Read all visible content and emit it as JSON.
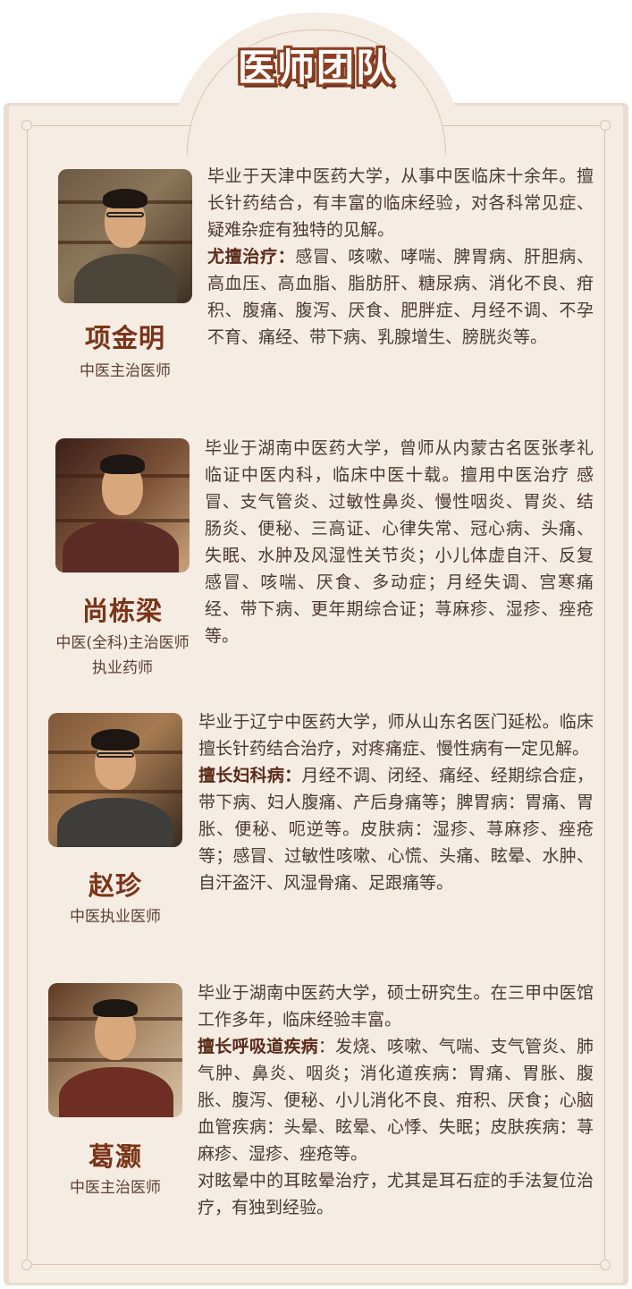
{
  "header": {
    "title": "医师团队"
  },
  "doctors": [
    {
      "name": "项金明",
      "titles": [
        "中医主治医师"
      ],
      "intro": "毕业于天津中医药大学，从事中医临床十余年。擅长针药结合，有丰富的临床经验，对各科常见症、疑难杂症有独特的见解。",
      "specialty_label": "尤擅治疗：",
      "specialty_text": "感冒、咳嗽、哮喘、脾胃病、肝胆病、高血压、高血脂、脂肪肝、糖尿病、消化不良、疳积、腹痛、腹泻、厌食、肥胖症、月经不调、不孕不育、痛经、带下病、乳腺增生、膀胱炎等。"
    },
    {
      "name": "尚栋梁",
      "titles": [
        "中医(全科)主治医师",
        "执业药师"
      ],
      "intro": "毕业于湖南中医药大学，曾师从内蒙古名医张孝礼临证中医内科，临床中医十载。擅用中医治疗 感冒、支气管炎、过敏性鼻炎、慢性咽炎、胃炎、结肠炎、便秘、三高证、心律失常、冠心病、头痛、失眠、水肿及风湿性关节炎；小儿体虚自汗、反复感冒、咳喘、厌食、多动症；月经失调、宫寒痛经、带下病、更年期综合证；荨麻疹、湿疹、痤疮等。"
    },
    {
      "name": "赵珍",
      "titles": [
        "中医执业医师"
      ],
      "intro": "毕业于辽宁中医药大学，师从山东名医门延松。临床擅长针药结合治疗，对疼痛症、慢性病有一定见解。",
      "specialty_label": "擅长妇科病：",
      "specialty_text": "月经不调、闭经、痛经、经期综合症，带下病、妇人腹痛、产后身痛等；脾胃病：胃痛、胃胀、便秘、呃逆等。皮肤病：湿疹、荨麻疹、痤疮等；感冒、过敏性咳嗽、心慌、头痛、眩晕、水肿、自汗盗汗、风湿骨痛、足跟痛等。"
    },
    {
      "name": "葛灏",
      "titles": [
        "中医主治医师"
      ],
      "intro": "毕业于湖南中医药大学，硕士研究生。在三甲中医馆工作多年，临床经验丰富。",
      "specialty_label": "擅长呼吸道疾病",
      "specialty_text": "：发烧、咳嗽、气喘、支气管炎、肺气肿、鼻炎、咽炎；消化道疾病：胃痛、胃胀、腹胀、腹泻、便秘、小儿消化不良、疳积、厌食；心脑血管疾病：头晕、眩晕、心悸、失眠；皮肤疾病：荨麻疹、湿疹、痤疮等。",
      "extra": "对眩晕中的耳眩晕治疗，尤其是耳石症的手法复位治疗，有独到经验。"
    }
  ]
}
